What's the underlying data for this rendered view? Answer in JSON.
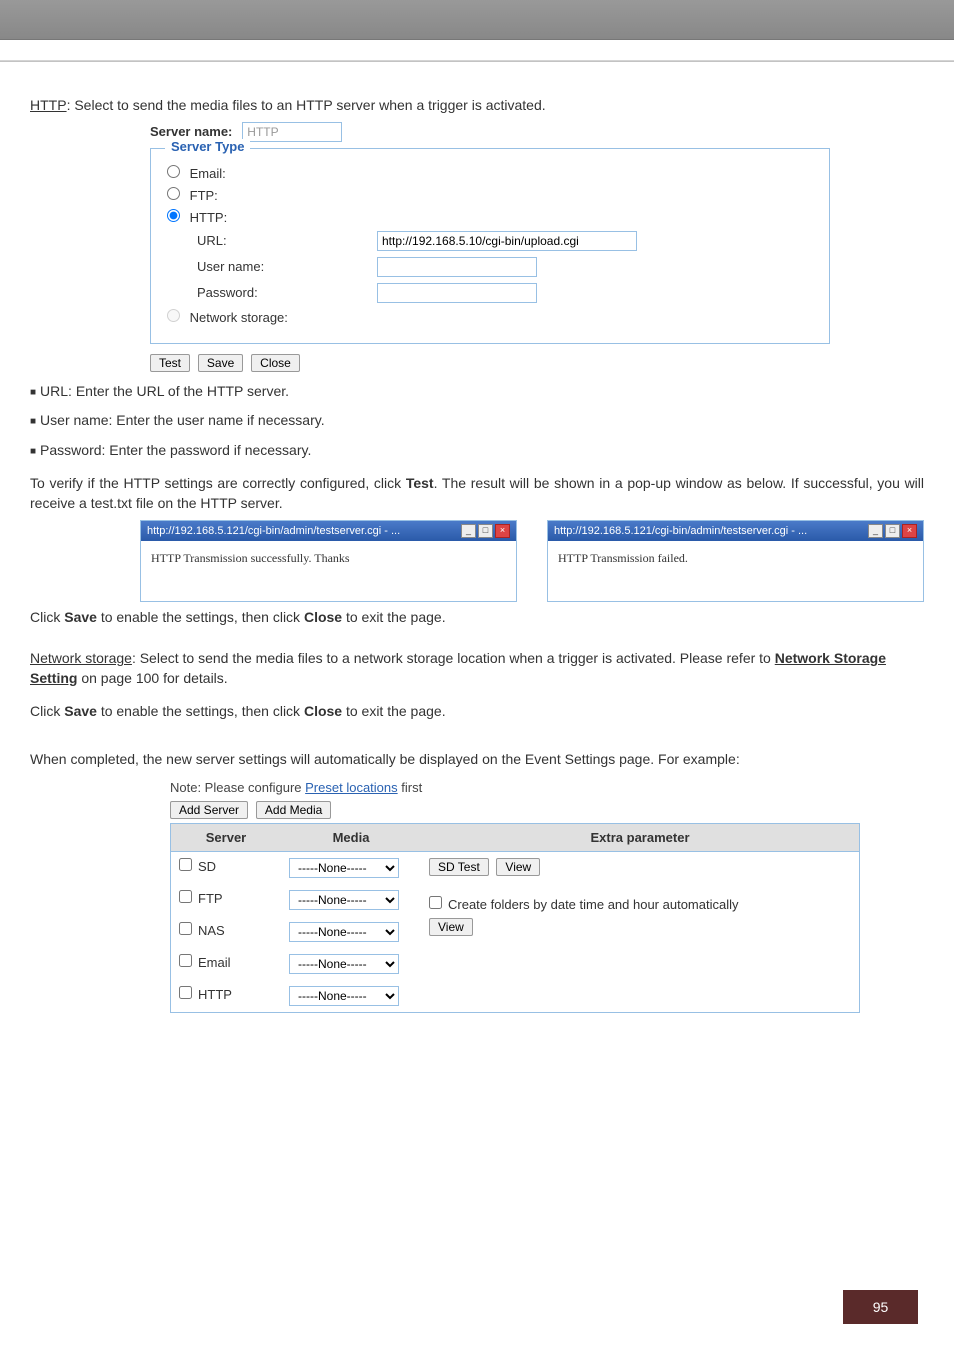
{
  "intro": "HTTP: Select to send the media files to an HTTP server when a trigger is activated.",
  "intro_prefix": "HTTP",
  "intro_suffix": ": Select to send the media files to an HTTP server when a trigger is activated.",
  "server_name_label": "Server name:",
  "server_name_value": "HTTP",
  "legend": "Server Type",
  "radios": {
    "email": "Email:",
    "ftp": "FTP:",
    "http": "HTTP:",
    "network_storage": "Network storage:"
  },
  "http_fields": {
    "url_label": "URL:",
    "url_value": "http://192.168.5.10/cgi-bin/upload.cgi",
    "user_label": "User name:",
    "pass_label": "Password:"
  },
  "buttons": {
    "test": "Test",
    "save": "Save",
    "close": "Close"
  },
  "bullets": {
    "url": "URL: Enter the URL of the HTTP server.",
    "user": "User name: Enter the user name if necessary.",
    "pass": "Password: Enter the password if necessary."
  },
  "verify_para": {
    "pre": "To verify if the HTTP settings are correctly configured, click ",
    "bold1": "Test",
    "mid": ". The result will be shown in a pop-up window as below. If successful, you will receive a test.txt file on the HTTP server."
  },
  "popup": {
    "title1": "http://192.168.5.121/cgi-bin/admin/testserver.cgi - ...",
    "body1": "HTTP Transmission successfully. Thanks",
    "title2": "http://192.168.5.121/cgi-bin/admin/testserver.cgi - ...",
    "body2": "HTTP Transmission failed."
  },
  "save_close_1": {
    "pre": "Click ",
    "b1": "Save",
    "mid": " to enable the settings, then click ",
    "b2": "Close",
    "post": " to exit the page."
  },
  "ns_para": {
    "u1": "Network storage",
    "text1": ": Select to send the media files to a network storage location when a trigger is activated. Please refer to ",
    "u2": "Network Storage Setting",
    "text2": " on page 100 for details."
  },
  "save_close_2": {
    "pre": "Click ",
    "b1": "Save",
    "mid": " to enable the settings, then click ",
    "b2": "Close",
    "post": " to exit the page."
  },
  "completed": "When completed, the new server settings will automatically be displayed on the Event Settings page. For example:",
  "event_note_pre": "Note: Please configure ",
  "event_note_link": "Preset locations",
  "event_note_post": " first",
  "event_buttons": {
    "add_server": "Add Server",
    "add_media": "Add Media"
  },
  "table": {
    "h_server": "Server",
    "h_media": "Media",
    "h_extra": "Extra parameter",
    "none_option": "-----None-----",
    "rows": {
      "sd": "SD",
      "ftp": "FTP",
      "nas": "NAS",
      "email": "Email",
      "http": "HTTP"
    },
    "sd_test": "SD Test",
    "view": "View",
    "create_folders": "Create folders by date time and hour automatically"
  },
  "page_number": "95"
}
